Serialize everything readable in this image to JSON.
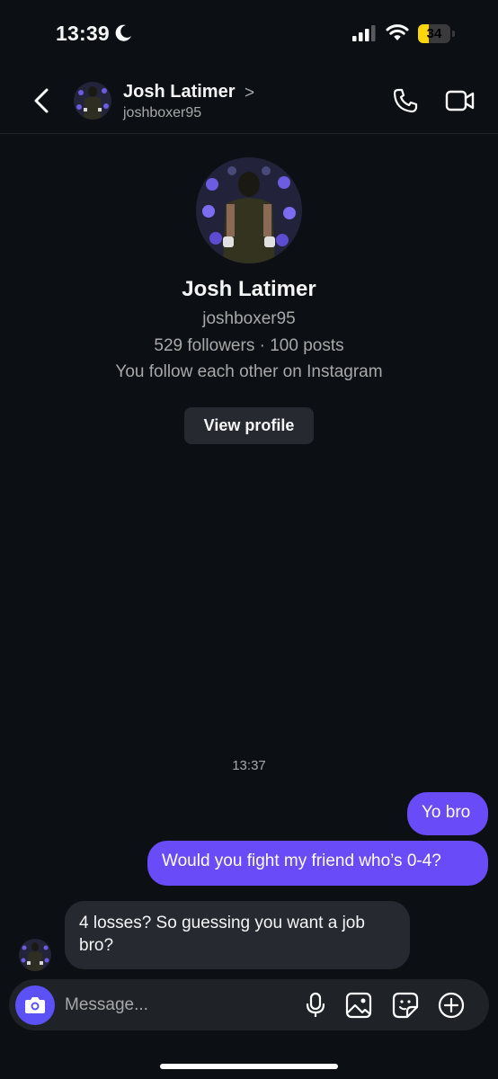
{
  "status_bar": {
    "time": "13:39",
    "battery_level": "34",
    "battery_fraction": 0.34,
    "icons": [
      "moon-icon",
      "signal-icon",
      "wifi-icon",
      "battery-icon"
    ]
  },
  "header": {
    "name": "Josh Latimer",
    "chevron": ">",
    "username": "joshboxer95",
    "icons": [
      "back-chevron-icon",
      "phone-icon",
      "video-camera-icon"
    ]
  },
  "profile": {
    "name": "Josh Latimer",
    "username": "joshboxer95",
    "stats": "529 followers · 100 posts",
    "relationship": "You follow each other on Instagram",
    "view_button": "View profile"
  },
  "conversation": {
    "timestamp": "13:37",
    "messages": [
      {
        "sender": "me",
        "text": "Yo bro"
      },
      {
        "sender": "me",
        "text": "Would you fight my friend who’s 0-4?"
      },
      {
        "sender": "them",
        "text": "4 losses? So guessing you want a job bro?"
      }
    ]
  },
  "composer": {
    "placeholder": "Message...",
    "icons": [
      "camera-icon",
      "microphone-icon",
      "gallery-icon",
      "sticker-icon",
      "plus-icon"
    ]
  },
  "colors": {
    "background": "#0c1014",
    "outgoing_bubble": "#6a4bf8",
    "incoming_bubble": "#262a30",
    "camera_button": "#5b51f7",
    "secondary_text": "#a8a8a8"
  }
}
